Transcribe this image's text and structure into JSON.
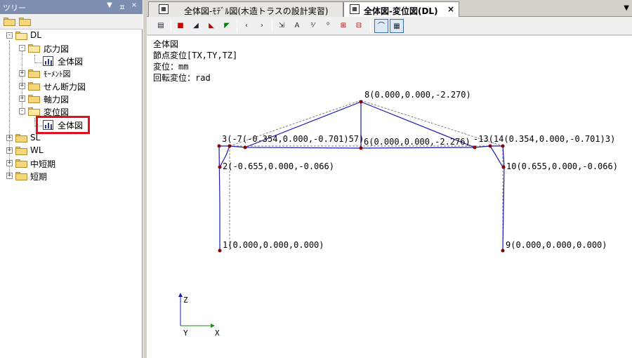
{
  "tree_pane": {
    "title": "ツリー",
    "controls": {
      "dropdown": "▼",
      "pin": "ㅍ",
      "close": "×"
    }
  },
  "tree": {
    "root": "DL",
    "dl_children": [
      {
        "label": "応力図",
        "expanded": true,
        "children": [
          "全体図"
        ]
      },
      {
        "label": "ﾓｰﾒﾝﾄ図",
        "expanded": false
      },
      {
        "label": "せん断力図",
        "expanded": false
      },
      {
        "label": "軸力図",
        "expanded": false
      },
      {
        "label": "変位図",
        "expanded": true,
        "children": [
          "全体図"
        ]
      }
    ],
    "other_roots": [
      "SL",
      "WL",
      "中短期",
      "短期"
    ]
  },
  "tabs": [
    {
      "label": "全体図-ﾓﾃﾞﾙ図(木造トラスの設計実習)",
      "active": false,
      "icon": "document-icon"
    },
    {
      "label": "全体図-変位図(DL)",
      "active": true,
      "icon": "document-icon"
    }
  ],
  "tab_menu_icon": "▼",
  "view": {
    "info_lines": [
      "全体図",
      "節点変位[TX,TY,TZ]",
      "変位：mm",
      "回転変位：rad"
    ],
    "node_labels": [
      {
        "id": "node-8",
        "text": "8(0.000,0.000,-2.270)"
      },
      {
        "id": "node-3-7",
        "text": "3(-7(-0.354,0.000,-0.701)57)"
      },
      {
        "id": "node-6",
        "text": "6(0.000,0.000,-2.276)"
      },
      {
        "id": "node-13-14",
        "text": "-13(14(0.354,0.000,-0.701)3)"
      },
      {
        "id": "node-2",
        "text": "2(-0.655,0.000,-0.066)"
      },
      {
        "id": "node-10",
        "text": "10(0.655,0.000,-0.066)"
      },
      {
        "id": "node-1",
        "text": "1(0.000,0.000,0.000)"
      },
      {
        "id": "node-9",
        "text": "9(0.000,0.000,0.000)"
      }
    ],
    "axes": {
      "z": "Z",
      "y": "Y",
      "x": "X"
    },
    "colors": {
      "deformed": "#1a1ab4",
      "original": "#808080",
      "node": "#8b0000",
      "x_axis": "#1a8a1a",
      "z_axis": "#1a1ab4"
    }
  }
}
